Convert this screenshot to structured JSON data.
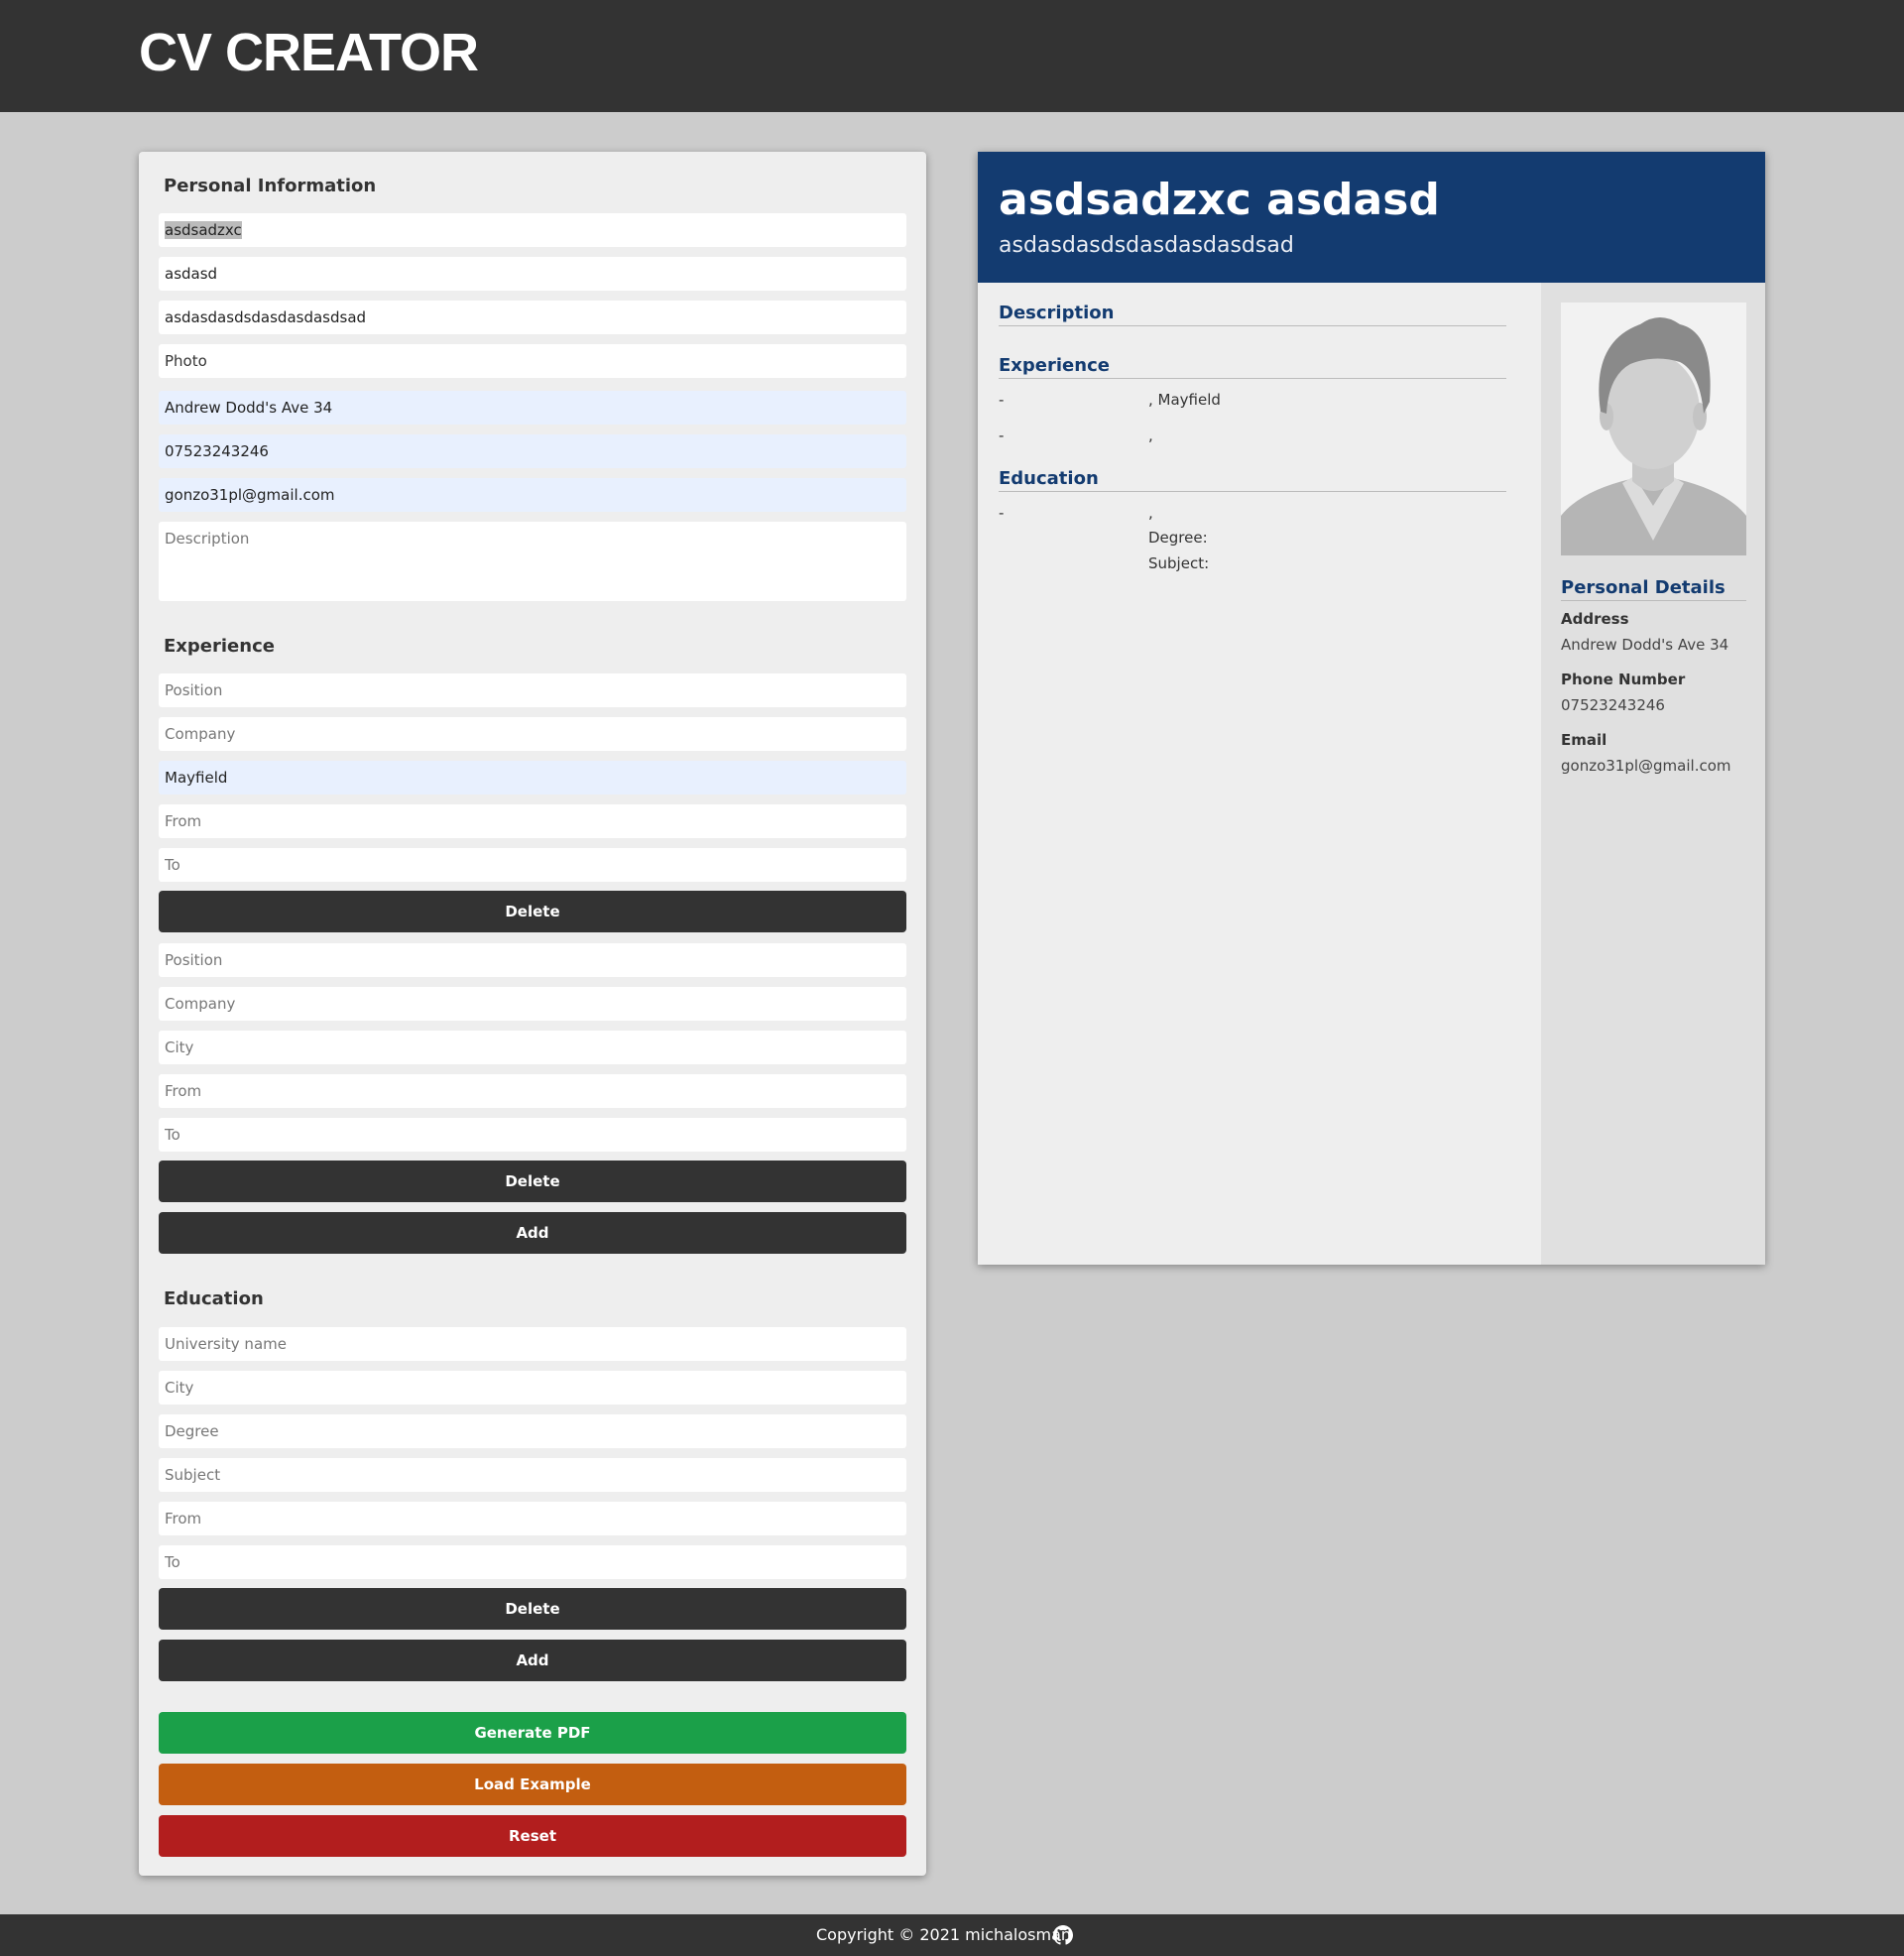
{
  "header": {
    "title": "CV CREATOR"
  },
  "form": {
    "personal": {
      "heading": "Personal Information",
      "first_name": {
        "value": "asdsadzxc"
      },
      "last_name": {
        "value": "asdasd"
      },
      "title": {
        "value": "asdasdasdsdasdasdasdsad"
      },
      "photo_label": "Photo",
      "address": {
        "value": "Andrew Dodd's Ave 34"
      },
      "phone": {
        "value": "07523243246"
      },
      "email": {
        "value": "gonzo31pl@gmail.com"
      },
      "description": {
        "placeholder": "Description"
      }
    },
    "experience": {
      "heading": "Experience",
      "entries": [
        {
          "position": {
            "placeholder": "Position"
          },
          "company": {
            "placeholder": "Company"
          },
          "city": {
            "value": "Mayfield"
          },
          "from": {
            "placeholder": "From"
          },
          "to": {
            "placeholder": "To"
          },
          "delete_label": "Delete"
        },
        {
          "position": {
            "placeholder": "Position"
          },
          "company": {
            "placeholder": "Company"
          },
          "city": {
            "placeholder": "City"
          },
          "from": {
            "placeholder": "From"
          },
          "to": {
            "placeholder": "To"
          },
          "delete_label": "Delete"
        }
      ],
      "add_label": "Add"
    },
    "education": {
      "heading": "Education",
      "entries": [
        {
          "university": {
            "placeholder": "University name"
          },
          "city": {
            "placeholder": "City"
          },
          "degree": {
            "placeholder": "Degree"
          },
          "subject": {
            "placeholder": "Subject"
          },
          "from": {
            "placeholder": "From"
          },
          "to": {
            "placeholder": "To"
          },
          "delete_label": "Delete"
        }
      ],
      "add_label": "Add"
    },
    "actions": {
      "generate_pdf": "Generate PDF",
      "load_example": "Load Example",
      "reset": "Reset"
    }
  },
  "preview": {
    "name": "asdsadzxc asdasd",
    "title": "asdasdasdsdasdasdasdsad",
    "description_heading": "Description",
    "experience_heading": "Experience",
    "experience_items": [
      {
        "dates": "-",
        "company_city": ", Mayfield"
      },
      {
        "dates": "-",
        "company_city": ","
      }
    ],
    "education_heading": "Education",
    "education_items": [
      {
        "dates": "-",
        "university_city": ",",
        "degree_label": "Degree:",
        "subject_label": "Subject:"
      }
    ],
    "personal_details": {
      "heading": "Personal Details",
      "address_label": "Address",
      "address": "Andrew Dodd's Ave 34",
      "phone_label": "Phone Number",
      "phone": "07523243246",
      "email_label": "Email",
      "email": "gonzo31pl@gmail.com"
    },
    "photo_icon": "avatar-placeholder-icon"
  },
  "footer": {
    "copyright": "Copyright © 2021 michalosman",
    "icon": "github-icon"
  },
  "colors": {
    "header_bg": "#333333",
    "page_bg": "#cccccc",
    "cv_header_bg": "#133b70",
    "generate_pdf": "#1ba049",
    "load_example": "#c35e10",
    "reset": "#b21e1e"
  }
}
